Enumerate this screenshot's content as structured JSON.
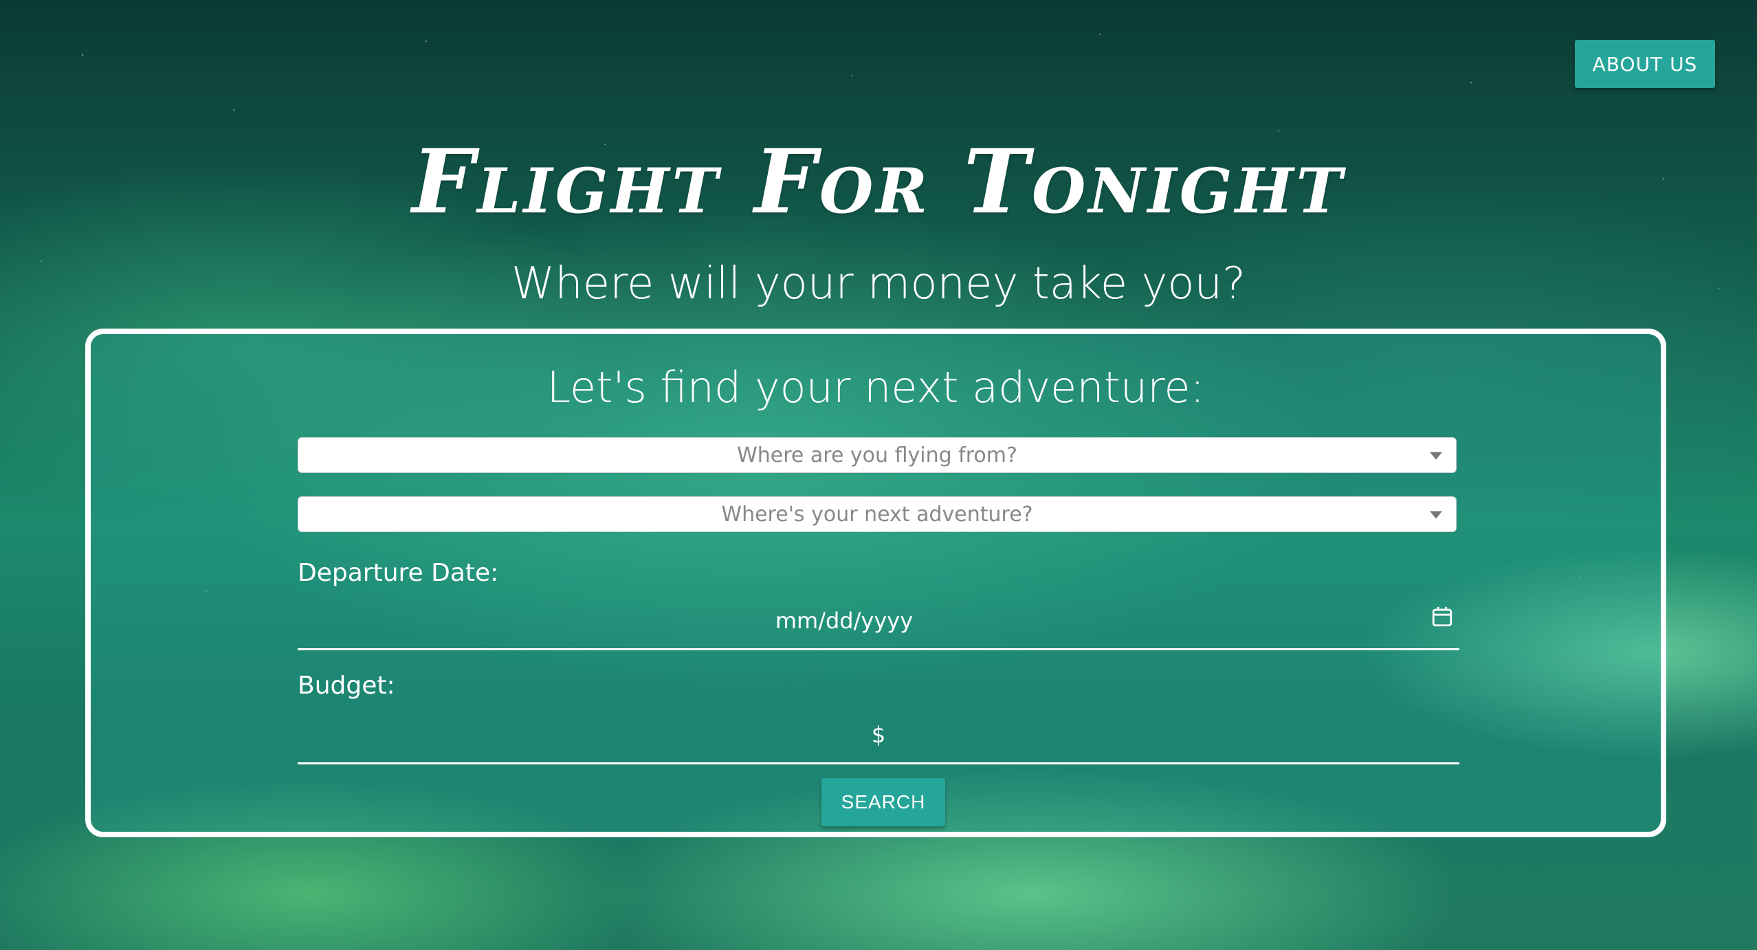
{
  "header": {
    "about_label": "ABOUT US"
  },
  "hero": {
    "title": "Flight For Tonight",
    "subtitle": "Where will your money take you?"
  },
  "form": {
    "heading": "Let's find your next adventure:",
    "origin_select": {
      "placeholder": "Where are you flying from?"
    },
    "destination_select": {
      "placeholder": "Where's your next adventure?"
    },
    "departure": {
      "label": "Departure Date:",
      "placeholder": "mm/dd/yyyy",
      "icon": "calendar-icon"
    },
    "budget": {
      "label": "Budget:",
      "prefix": "$"
    },
    "search_label": "SEARCH"
  },
  "colors": {
    "accent": "#26a69a",
    "text": "#ffffff"
  }
}
